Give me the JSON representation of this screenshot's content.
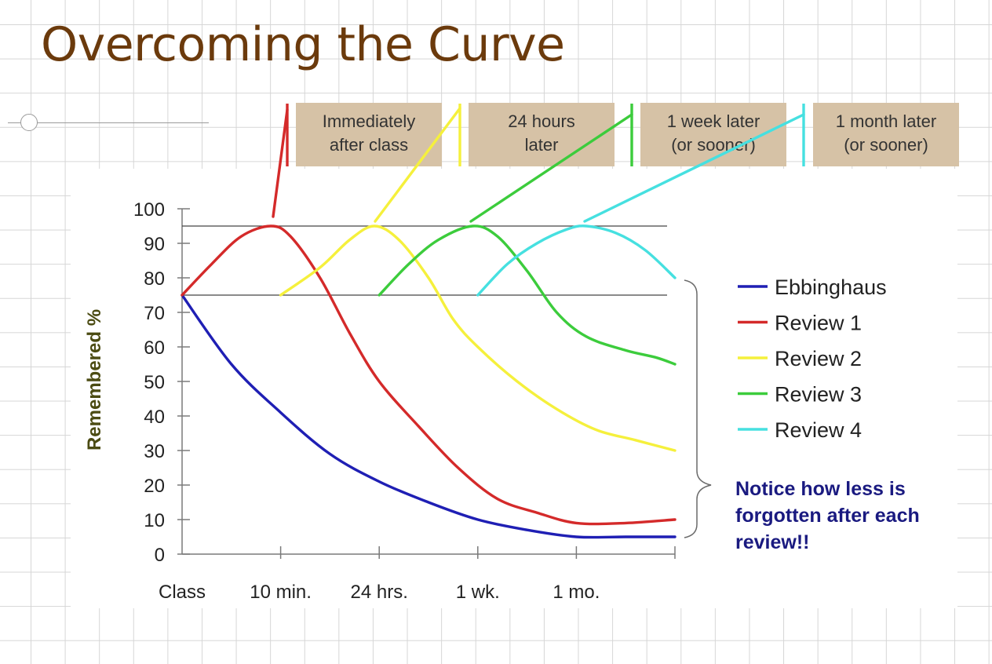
{
  "title": "Overcoming the Curve",
  "note": "Notice how less is forgotten after each review!!",
  "colors": {
    "title": "#6b3a0c",
    "box_fill": "#d6c2a6",
    "note": "#1a1a80",
    "ebbinghaus": "#1f1fb4",
    "review1": "#d42a2a",
    "review2": "#f5f03c",
    "review3": "#3ccc3c",
    "review4": "#46e0e0"
  },
  "review_boxes": [
    {
      "lines": [
        "Immediately",
        "after class"
      ],
      "series": "Review 1"
    },
    {
      "lines": [
        "24 hours",
        "later"
      ],
      "series": "Review 2"
    },
    {
      "lines": [
        "1 week later",
        "(or sooner)"
      ],
      "series": "Review 3"
    },
    {
      "lines": [
        "1 month later",
        "(or sooner)"
      ],
      "series": "Review 4"
    }
  ],
  "chart_data": {
    "type": "line",
    "title": "",
    "xlabel": "",
    "ylabel": "Remembered %",
    "categories": [
      "Class",
      "10 min.",
      "24 hrs.",
      "1 wk.",
      "1 mo.",
      ""
    ],
    "ylim": [
      0,
      100
    ],
    "yticks": [
      0,
      10,
      20,
      30,
      40,
      50,
      60,
      70,
      80,
      90,
      100
    ],
    "reference_lines": [
      95,
      75
    ],
    "legend_position": "right",
    "series": [
      {
        "name": "Ebbinghaus",
        "color": "#1f1fb4",
        "points": [
          [
            0,
            75
          ],
          [
            0.5,
            55
          ],
          [
            1,
            41
          ],
          [
            1.5,
            29
          ],
          [
            2,
            21
          ],
          [
            2.5,
            15
          ],
          [
            3,
            10
          ],
          [
            3.5,
            7
          ],
          [
            4,
            5
          ],
          [
            4.5,
            5
          ],
          [
            5,
            5
          ]
        ]
      },
      {
        "name": "Review 1",
        "color": "#d42a2a",
        "points": [
          [
            0,
            75
          ],
          [
            0.3,
            84
          ],
          [
            0.6,
            92
          ],
          [
            0.9,
            95
          ],
          [
            1.1,
            92
          ],
          [
            1.4,
            80
          ],
          [
            1.7,
            64
          ],
          [
            2,
            50
          ],
          [
            2.4,
            37
          ],
          [
            2.8,
            25
          ],
          [
            3.2,
            16
          ],
          [
            3.6,
            12
          ],
          [
            4,
            9
          ],
          [
            4.5,
            9
          ],
          [
            5,
            10
          ]
        ]
      },
      {
        "name": "Review 2",
        "color": "#f5f03c",
        "points": [
          [
            1,
            75
          ],
          [
            1.4,
            83
          ],
          [
            1.7,
            91
          ],
          [
            1.95,
            95
          ],
          [
            2.2,
            91
          ],
          [
            2.5,
            80
          ],
          [
            2.75,
            68
          ],
          [
            3,
            60
          ],
          [
            3.4,
            50
          ],
          [
            3.8,
            42
          ],
          [
            4.2,
            36
          ],
          [
            4.6,
            33
          ],
          [
            5,
            30
          ]
        ]
      },
      {
        "name": "Review 3",
        "color": "#3ccc3c",
        "points": [
          [
            2,
            75
          ],
          [
            2.3,
            84
          ],
          [
            2.6,
            91
          ],
          [
            2.95,
            95
          ],
          [
            3.2,
            92
          ],
          [
            3.5,
            82
          ],
          [
            3.8,
            70
          ],
          [
            4.1,
            63
          ],
          [
            4.5,
            59
          ],
          [
            4.8,
            57
          ],
          [
            5,
            55
          ]
        ]
      },
      {
        "name": "Review 4",
        "color": "#46e0e0",
        "points": [
          [
            3,
            75
          ],
          [
            3.3,
            84
          ],
          [
            3.6,
            90
          ],
          [
            3.9,
            94
          ],
          [
            4.1,
            95
          ],
          [
            4.4,
            93
          ],
          [
            4.7,
            88
          ],
          [
            5,
            80
          ]
        ]
      }
    ]
  }
}
